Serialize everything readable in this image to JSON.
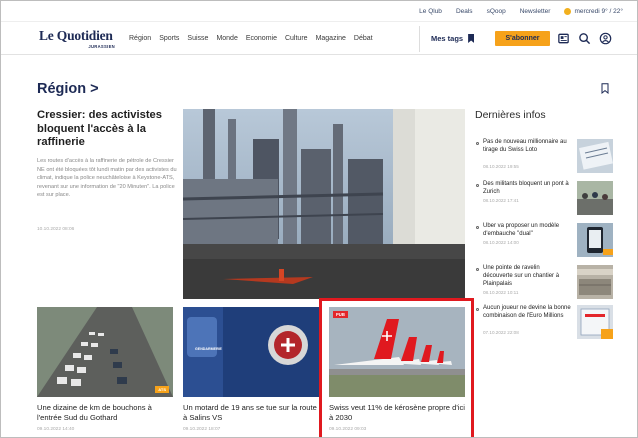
{
  "util_bar": {
    "links": [
      "Le Qlub",
      "Deals",
      "sQoop",
      "Newsletter"
    ],
    "weather": "mercredi 9° / 22°"
  },
  "header": {
    "logo": "Le Quotidien",
    "logo_sub": "JURASSIEN",
    "nav": [
      "Région",
      "Sports",
      "Suisse",
      "Monde",
      "Economie",
      "Culture",
      "Magazine",
      "Débat"
    ],
    "mes_tags": "Mes tags",
    "subscribe": "S'abonner",
    "icons": [
      "newspaper-icon",
      "search-icon",
      "user-icon"
    ]
  },
  "section": {
    "title": "Région >"
  },
  "lead": {
    "title": "Cressier: des activistes bloquent l'accès à la raffinerie",
    "text": "Les routes d'accès à la raffinerie de pétrole de Cressier NE ont été bloquées tôt lundi matin par des activistes du climat, indique la police neuchâteloise à Keystone-ATS, revenant sur une information de \"20 Minuten\". La police est sur place.",
    "date": "10.10.2022 08:06"
  },
  "sidebar": {
    "title": "Dernières infos",
    "items": [
      {
        "title": "Pas de nouveau millionnaire au tirage du Swiss Loto",
        "date": "08.10.2022 19:55"
      },
      {
        "title": "Des militants bloquent un pont à Zurich",
        "date": "08.10.2022 17:41"
      },
      {
        "title": "Uber va proposer un modèle d'embauche \"dual\"",
        "date": "08.10.2022 14:00"
      },
      {
        "title": "Une pointe de ravelin découverte sur un chantier à Plainpalais",
        "date": "08.10.2022 10:11"
      },
      {
        "title": "Aucun joueur ne devine la bonne combinaison de l'Euro Millions",
        "date": "07.10.2022 22:08"
      }
    ]
  },
  "cards": [
    {
      "title": "Une dizaine de km de bouchons à l'entrée Sud du Gothard",
      "date": "09.10.2022 14:40",
      "tag": "ATS"
    },
    {
      "title": "Un motard de 19 ans se tue sur la route à Salins VS",
      "date": "09.10.2022 18:07",
      "badge": "GENDARMERIE"
    },
    {
      "title": "Swiss veut 11% de kérosène propre d'ici à 2030",
      "date": "09.10.2022 09:03",
      "label": "PUB"
    }
  ],
  "colors": {
    "brand_navy": "#1d2a55",
    "accent_orange": "#f6a21a",
    "highlight_red": "#e0191f"
  }
}
